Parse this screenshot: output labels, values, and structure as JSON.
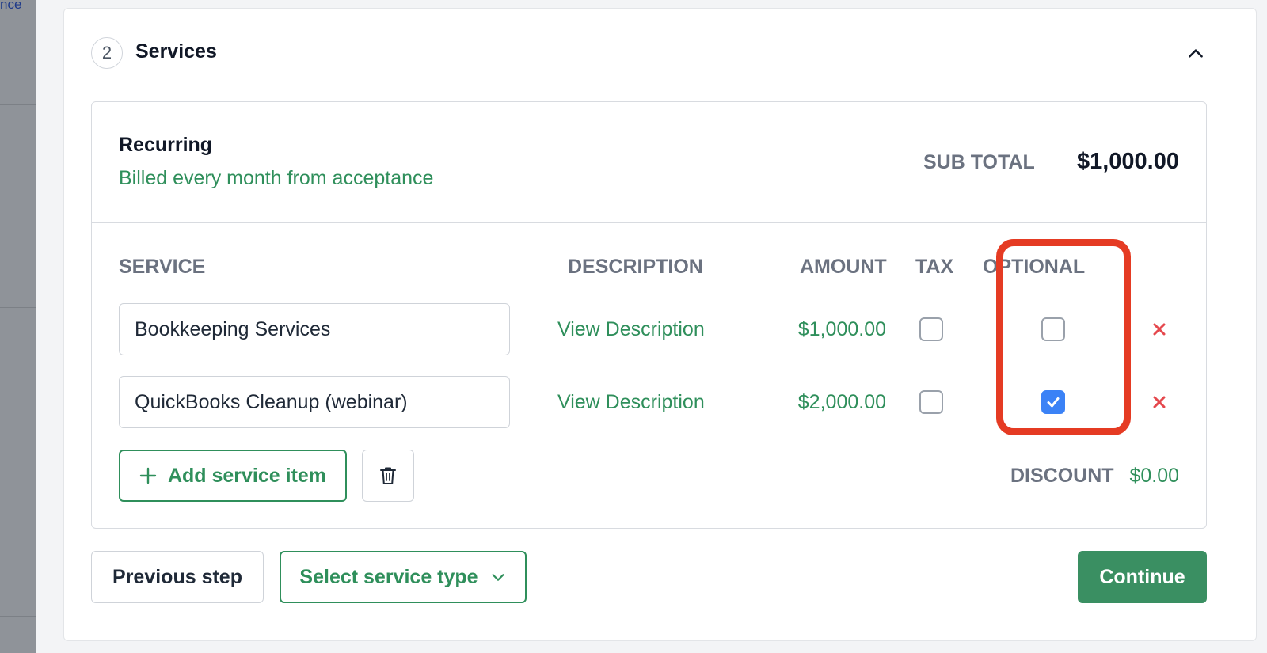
{
  "backdrop": {
    "partial_text": "nce"
  },
  "step": {
    "number": "2",
    "title": "Services"
  },
  "group": {
    "title": "Recurring",
    "subtitle": "Billed every month from acceptance",
    "subtotal_label": "SUB TOTAL",
    "subtotal_value": "$1,000.00"
  },
  "columns": {
    "service": "SERVICE",
    "description": "DESCRIPTION",
    "amount": "AMOUNT",
    "tax": "TAX",
    "optional": "OPTIONAL"
  },
  "rows": [
    {
      "service": "Bookkeeping Services",
      "description_link": "View Description",
      "amount": "$1,000.00",
      "tax": false,
      "optional": false
    },
    {
      "service": "QuickBooks Cleanup (webinar)",
      "description_link": "View Description",
      "amount": "$2,000.00",
      "tax": false,
      "optional": true
    }
  ],
  "actions": {
    "add_item_label": "Add service item",
    "discount_label": "DISCOUNT",
    "discount_value": "$0.00"
  },
  "footer": {
    "previous_label": "Previous step",
    "select_type_label": "Select service type",
    "continue_label": "Continue"
  },
  "colors": {
    "accent_green": "#2f8f5b",
    "continue_green": "#3a8f62",
    "checkbox_blue": "#3b82f6",
    "remove_red": "#e5484d",
    "highlight_red": "#e53b23"
  }
}
